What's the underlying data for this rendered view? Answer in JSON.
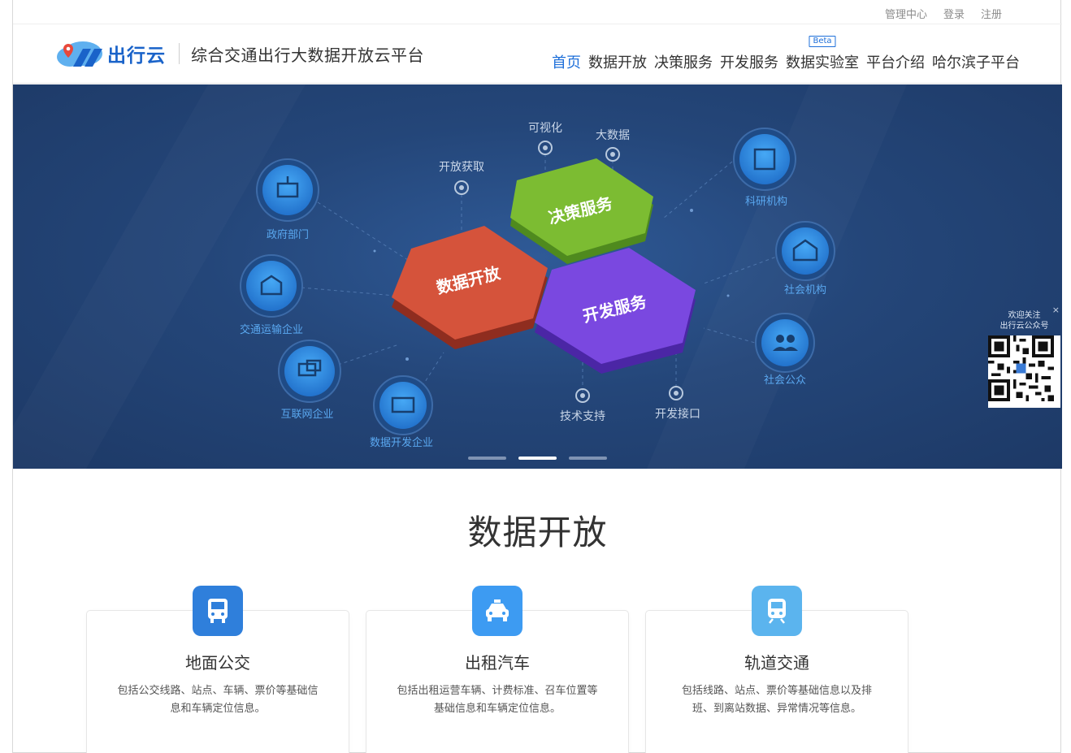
{
  "topbar": {
    "links": [
      "管理中心",
      "登录",
      "注册"
    ]
  },
  "header": {
    "logo_text": "出行云",
    "slogan": "综合交通出行大数据开放云平台",
    "nav": [
      {
        "label": "首页",
        "active": true
      },
      {
        "label": "数据开放"
      },
      {
        "label": "决策服务"
      },
      {
        "label": "开发服务"
      },
      {
        "label": "数据实验室",
        "badge": "Beta"
      },
      {
        "label": "平台介绍"
      },
      {
        "label": "哈尔滨子平台"
      }
    ]
  },
  "banner": {
    "hex_labels": {
      "red": "数据开放",
      "green": "决策服务",
      "purple": "开发服务"
    },
    "pin_labels": [
      "开放获取",
      "可视化",
      "大数据",
      "技术支持",
      "开发接口"
    ],
    "left_nodes": [
      "政府部门",
      "交通运输企业",
      "互联网企业",
      "数据开发企业"
    ],
    "right_nodes": [
      "科研机构",
      "社会机构",
      "社会公众"
    ],
    "slides": 3,
    "active_slide": 2,
    "qr": {
      "title_line1": "欢迎关注",
      "title_line2": "出行云公众号",
      "close": "×"
    }
  },
  "section": {
    "title": "数据开放",
    "cards": [
      {
        "title": "地面公交",
        "desc": "包括公交线路、站点、车辆、票价等基础信息和车辆定位信息。",
        "icon": "bus-icon",
        "color": "#2f7fdb"
      },
      {
        "title": "出租汽车",
        "desc": "包括出租运营车辆、计费标准、召车位置等基础信息和车辆定位信息。",
        "icon": "taxi-icon",
        "color": "#3d9bf2"
      },
      {
        "title": "轨道交通",
        "desc": "包括线路、站点、票价等基础信息以及排班、到离站数据、异常情况等信息。",
        "icon": "metro-icon",
        "color": "#5bb4ee"
      }
    ]
  },
  "colors": {
    "brand": "#1a63c9",
    "nav_active": "#1e6fd9",
    "banner_bg": "#244679",
    "hex_red": "#d5533b",
    "hex_green": "#7cbc32",
    "hex_purple": "#7a48e0",
    "node_blue": "#2e8ae6"
  }
}
